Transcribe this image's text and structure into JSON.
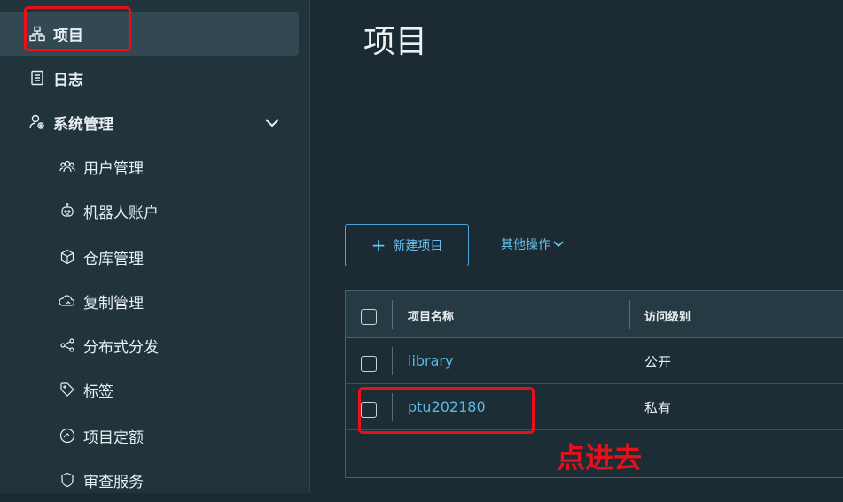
{
  "sidebar": {
    "items": [
      {
        "label": "项目",
        "icon": "project-icon"
      },
      {
        "label": "日志",
        "icon": "log-icon"
      },
      {
        "label": "系统管理",
        "icon": "admin-icon"
      },
      {
        "label": "用户管理",
        "icon": "users-icon"
      },
      {
        "label": "机器人账户",
        "icon": "robot-icon"
      },
      {
        "label": "仓库管理",
        "icon": "cube-icon"
      },
      {
        "label": "复制管理",
        "icon": "cloud-icon"
      },
      {
        "label": "分布式分发",
        "icon": "share-icon"
      },
      {
        "label": "标签",
        "icon": "tag-icon"
      },
      {
        "label": "项目定额",
        "icon": "gauge-icon"
      },
      {
        "label": "审查服务",
        "icon": "shield-icon"
      }
    ]
  },
  "main": {
    "title": "项目",
    "new_project_button": "新建项目",
    "other_actions": "其他操作",
    "table": {
      "columns": [
        "项目名称",
        "访问级别"
      ],
      "rows": [
        {
          "name": "library",
          "access": "公开"
        },
        {
          "name": "ptu202180",
          "access": "私有"
        }
      ]
    }
  },
  "annotation": "点进去",
  "colors": {
    "accent": "#5fb7e6",
    "highlight": "#e8101a",
    "sidebar_bg": "#21333b",
    "main_bg": "#1b2a33"
  }
}
